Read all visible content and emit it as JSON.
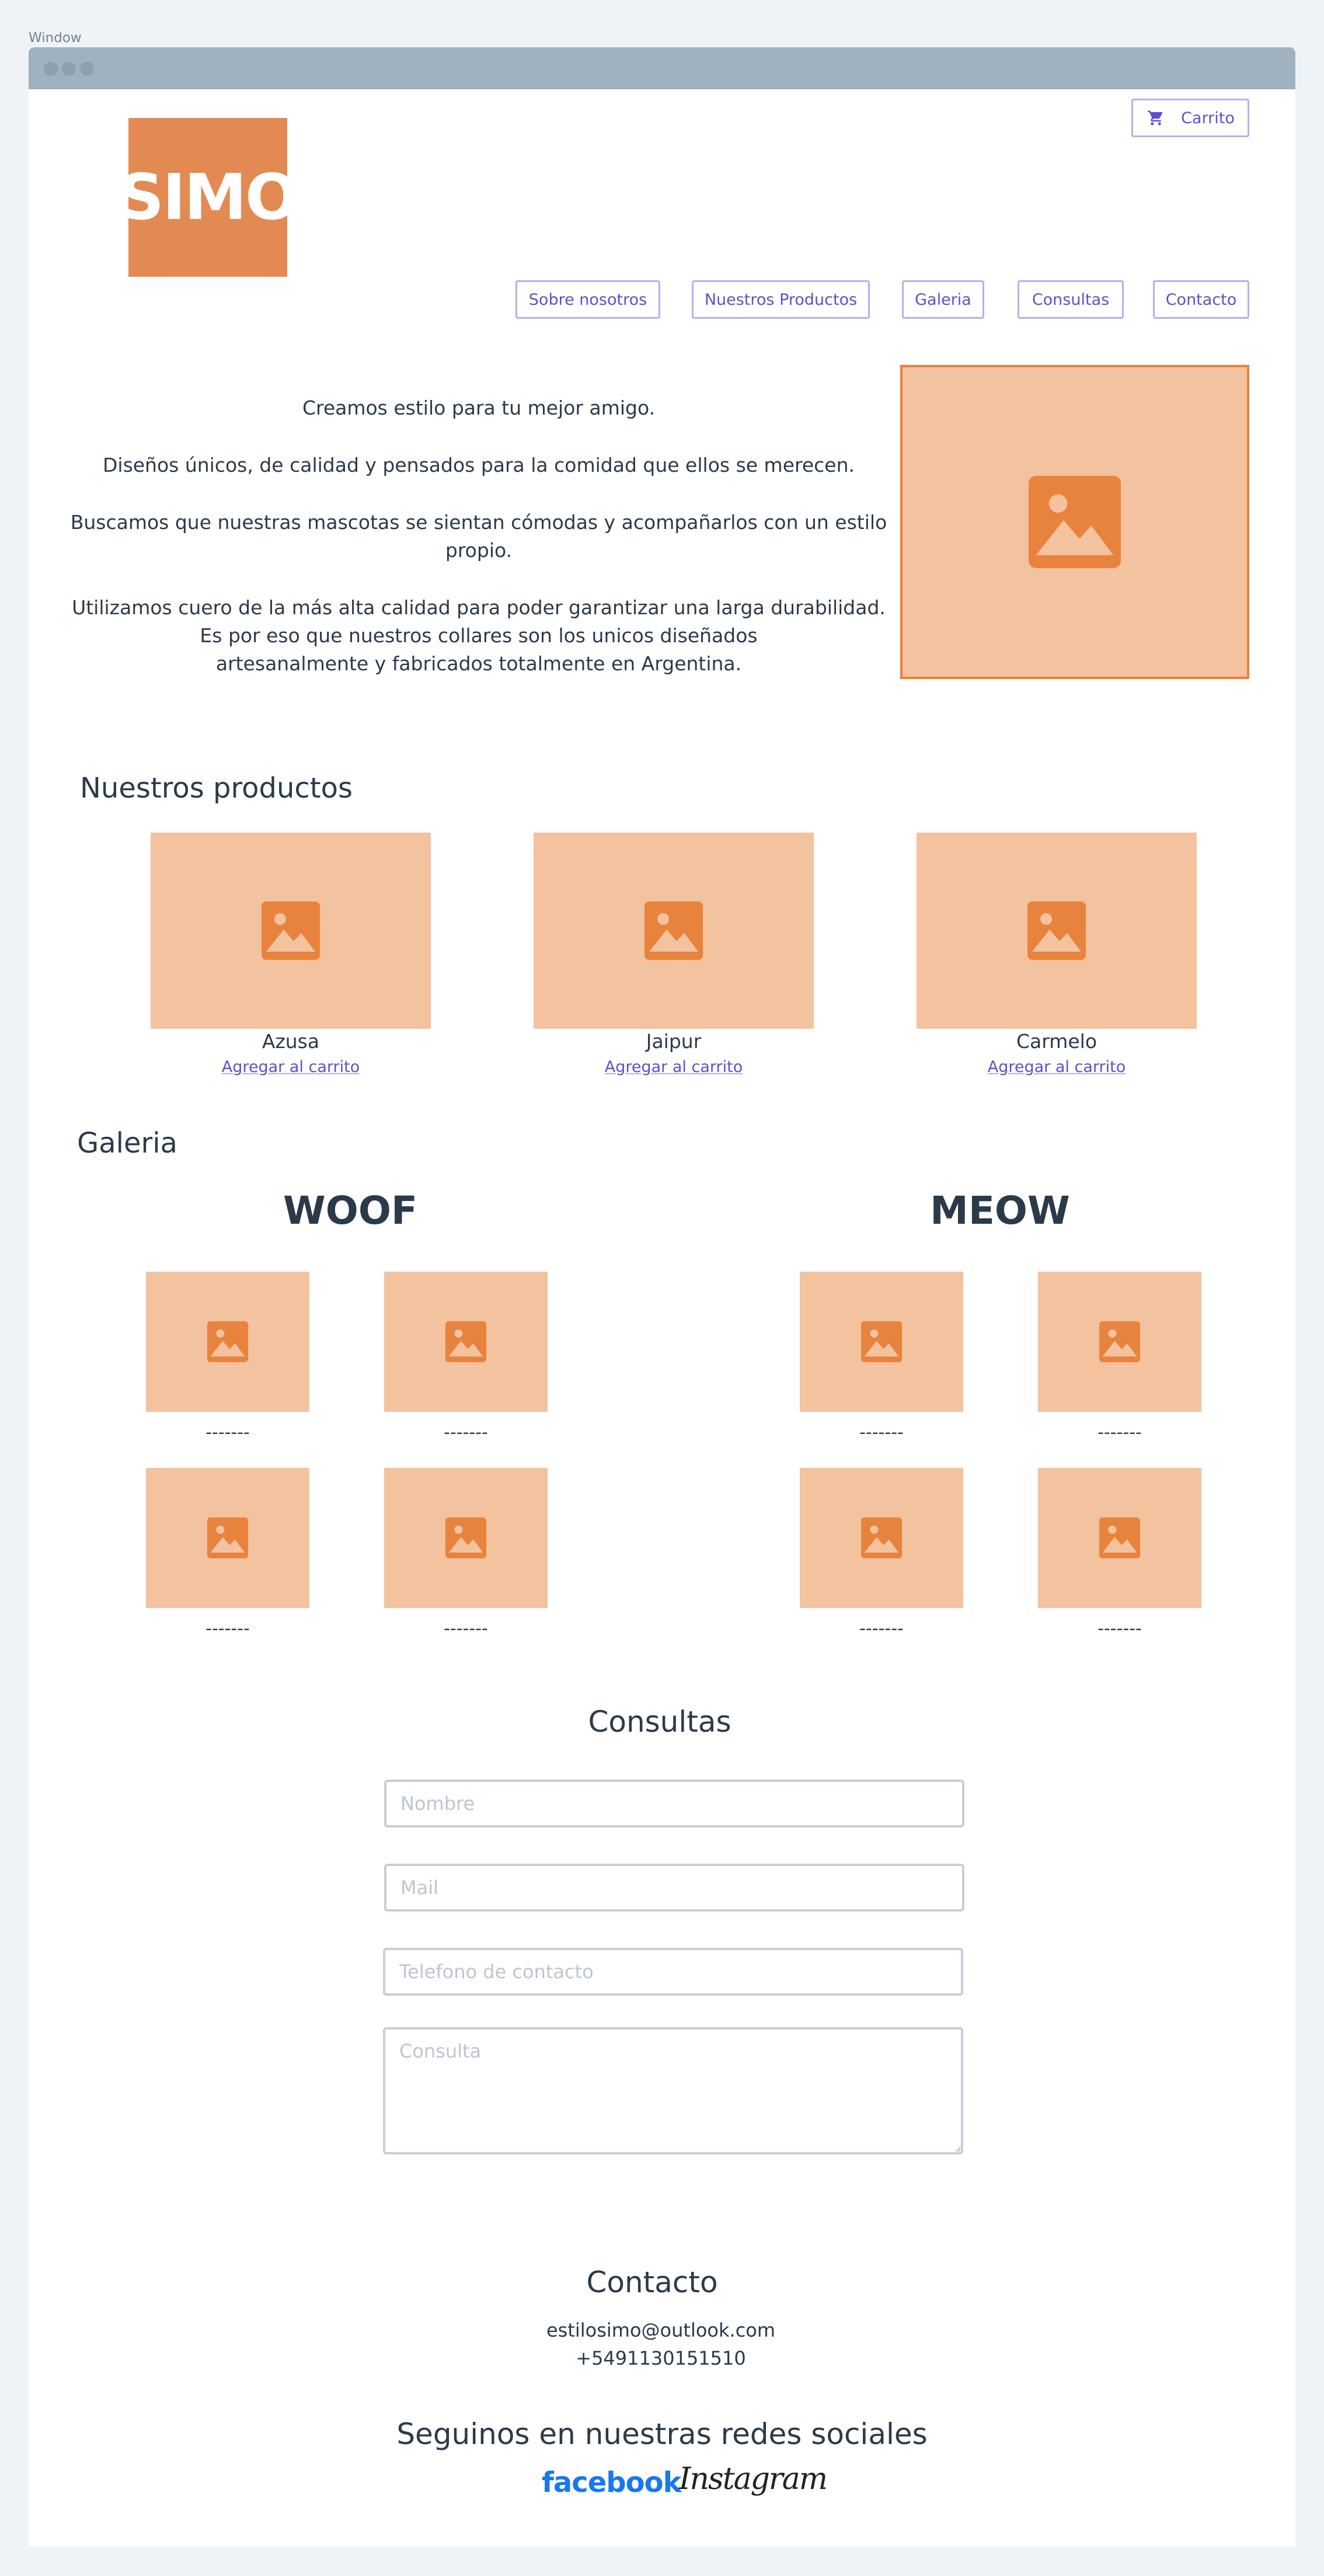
{
  "window": {
    "label": "Window"
  },
  "brand": {
    "logo_text": "SIMO",
    "accent": "#e38a52",
    "placeholder_bg": "#f3c29f",
    "link_color": "#5a51d0"
  },
  "cart": {
    "label": "Carrito",
    "icon": "cart-icon"
  },
  "nav": {
    "items": [
      {
        "label": "Sobre nosotros"
      },
      {
        "label": "Nuestros Productos"
      },
      {
        "label": "Galeria"
      },
      {
        "label": "Consultas"
      },
      {
        "label": "Contacto"
      }
    ]
  },
  "hero": {
    "line1": "Creamos estilo para tu mejor amigo.",
    "line2": "Diseños  únicos, de calidad y pensados para la comidad que ellos se merecen.",
    "line3": "Buscamos que nuestras mascotas se sientan cómodas y acompañarlos con un estilo propio.",
    "line4": "Utilizamos cuero de la más alta calidad para poder garantizar una larga durabilidad.",
    "line5": "Es por eso que nuestros collares son los unicos diseñados artesanalmente y fabricados totalmente en Argentina.",
    "image_icon": "image-icon"
  },
  "products": {
    "title": "Nuestros productos",
    "items": [
      {
        "name": "Azusa",
        "link": "Agregar al carrito"
      },
      {
        "name": "Jaipur",
        "link": "Agregar al carrito"
      },
      {
        "name": "Carmelo",
        "link": "Agregar al carrito"
      }
    ]
  },
  "gallery": {
    "title": "Galeria",
    "woof": {
      "title": "WOOF",
      "captions": [
        "-------",
        "-------",
        "-------",
        "-------"
      ]
    },
    "meow": {
      "title": "MEOW",
      "captions": [
        "-------",
        "-------",
        "-------",
        "-------"
      ]
    }
  },
  "consultas": {
    "title": "Consultas",
    "name_placeholder": "Nombre",
    "mail_placeholder": "Mail",
    "phone_placeholder": "Telefono de contacto",
    "query_placeholder": "Consulta"
  },
  "contacto": {
    "title": "Contacto",
    "email": "estilosimo@outlook.com",
    "phone": "+5491130151510"
  },
  "social": {
    "title": "Seguinos en nuestras redes sociales",
    "facebook": "facebook",
    "instagram": "Instagram",
    "facebook_color": "#1877f2"
  }
}
